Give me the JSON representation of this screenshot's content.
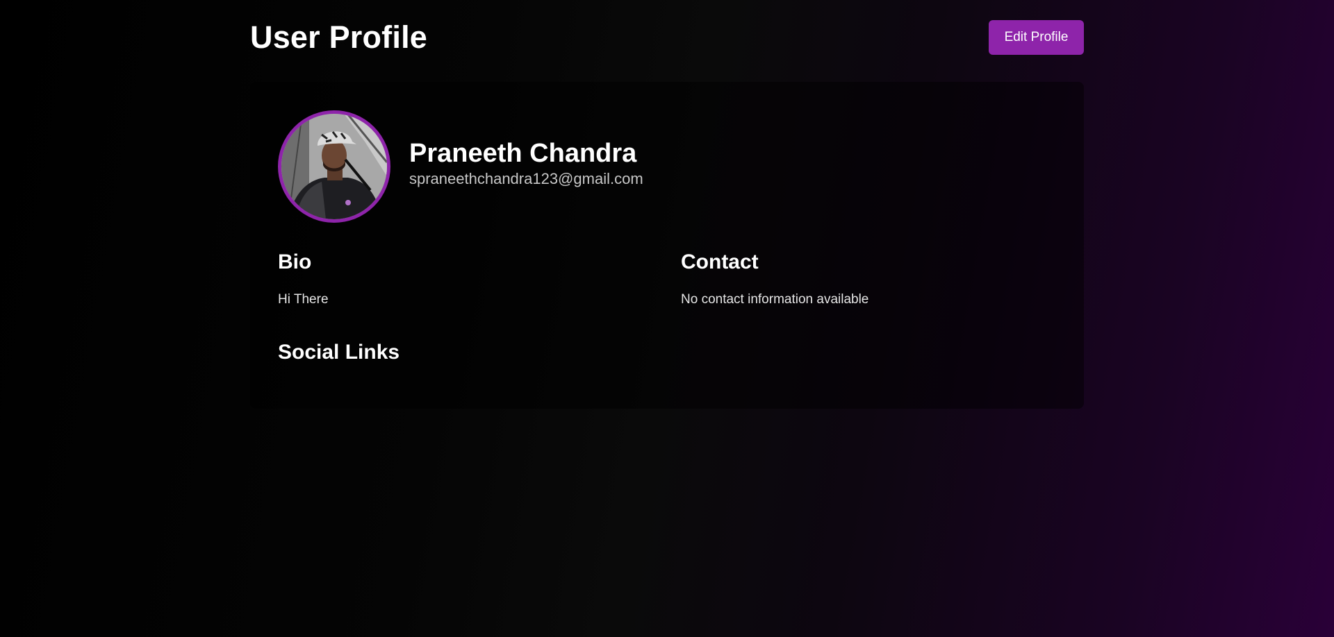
{
  "header": {
    "title": "User Profile",
    "edit_button_label": "Edit Profile"
  },
  "profile": {
    "name": "Praneeth Chandra",
    "email": "spraneethchandra123@gmail.com",
    "avatar_alt": "profile photo"
  },
  "sections": {
    "bio": {
      "heading": "Bio",
      "text": "Hi There"
    },
    "contact": {
      "heading": "Contact",
      "text": "No contact information available"
    },
    "social": {
      "heading": "Social Links"
    }
  },
  "colors": {
    "accent": "#8e24aa",
    "background_start": "#000000",
    "background_end": "#2a0038",
    "text_primary": "#ffffff",
    "text_secondary": "#c8c8c8"
  }
}
